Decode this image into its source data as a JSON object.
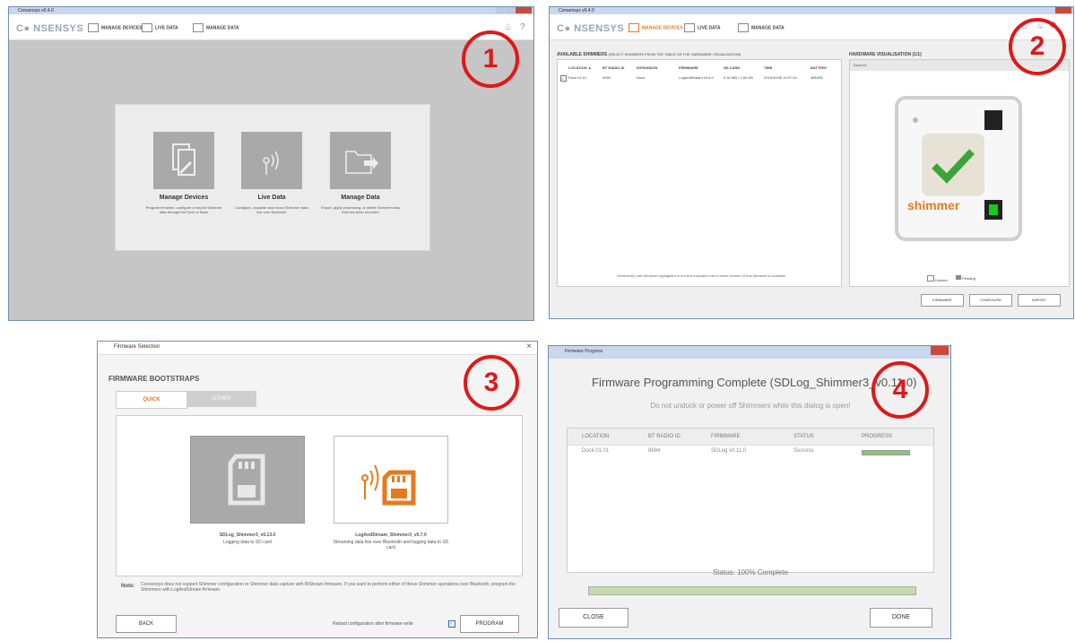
{
  "app_title": "Consensys v0.4.0",
  "logo": "C● NSENSYS",
  "nav": {
    "manage_devices": "MANAGE DEVICES",
    "live_data": "LIVE DATA",
    "manage_data": "MANAGE DATA"
  },
  "markers": [
    "1",
    "2",
    "3",
    "4"
  ],
  "panel1": {
    "tiles": [
      {
        "title": "Manage Devices",
        "desc": "Program firmware, configure or import Shimmer data through the Dock or Base",
        "icon": "device-wrench-icon"
      },
      {
        "title": "Live Data",
        "desc": "Configure, visualise and record Shimmer data live over Bluetooth",
        "icon": "bluetooth-signal-icon"
      },
      {
        "title": "Manage Data",
        "desc": "Export, apply processing, or delete Shimmer data that has been recorded",
        "icon": "folder-export-icon"
      }
    ]
  },
  "panel2": {
    "shimmers_title": "AVAILABLE SHIMMERS",
    "shimmers_hint": "(SELECT SHIMMERS FROM THE TABLE OR THE HARDWARE VISUALISATION)",
    "columns": [
      "LOCATION ▲",
      "BT RADIO ID",
      "EXPANSION",
      "FIRMWARE",
      "SD CARD",
      "TIME",
      "BATTERY"
    ],
    "rows": [
      [
        "Dock.01.01",
        "9090",
        "None",
        "LogAndStream v0.6.0",
        "0.34 MB / 1.84 GB",
        "2015/10/08 10:07:04",
        "100.0%"
      ]
    ],
    "note": "Shimmer(s) with firmware highlighted in red text indicates that a newer version of that firmware is available",
    "hw_title": "HARDWARE VISUALISATION (1/1)",
    "hw_dock": "Dock.01",
    "brand": "shimmer",
    "legend_docked": "Docked",
    "legend_pending": "Pending",
    "buttons": [
      "FIRMWARE",
      "CONFIGURE",
      "IMPORT"
    ]
  },
  "panel3": {
    "window_title": "Firmware Selection",
    "heading": "FIRMWARE BOOTSTRAPS",
    "tab_quick": "QUICK",
    "tab_other": "OTHER",
    "cards": [
      {
        "name": "SDLog_Shimmer3_v0.13.0",
        "desc": "Logging data to SD card"
      },
      {
        "name": "LogAndStream_Shimmer3_v0.7.0",
        "desc": "Streaming data live over Bluetooth and logging data to SD card"
      }
    ],
    "note_label": "Note:",
    "note": "Consensys does not support Shimmer configuration or Shimmer data capture with BtStream firmware. If you want to perform either of these Shimmer operations over Bluetooth, program the Shimmers with LogAndStream firmware.",
    "back": "BACK",
    "reload_label": "Reload configuration after firmware write",
    "program": "PROGRAM"
  },
  "panel4": {
    "window_title": "Firmware Progress",
    "title": "Firmware Programming Complete (SDLog_Shimmer3_v0.11.0)",
    "subtitle": "Do not undock or power off Shimmers while this dialog is open!",
    "columns": [
      "LOCATION",
      "BT RADIO ID",
      "FIRMWARE",
      "STATUS",
      "PROGRESS"
    ],
    "rows": [
      [
        "Dock.01.01",
        "8694",
        "SDLog v0.11.0",
        "Success"
      ]
    ],
    "row_progress": 1.0,
    "status": "Status: 100% Complete",
    "overall_progress": 1.0,
    "close": "CLOSE",
    "done": "DONE"
  }
}
